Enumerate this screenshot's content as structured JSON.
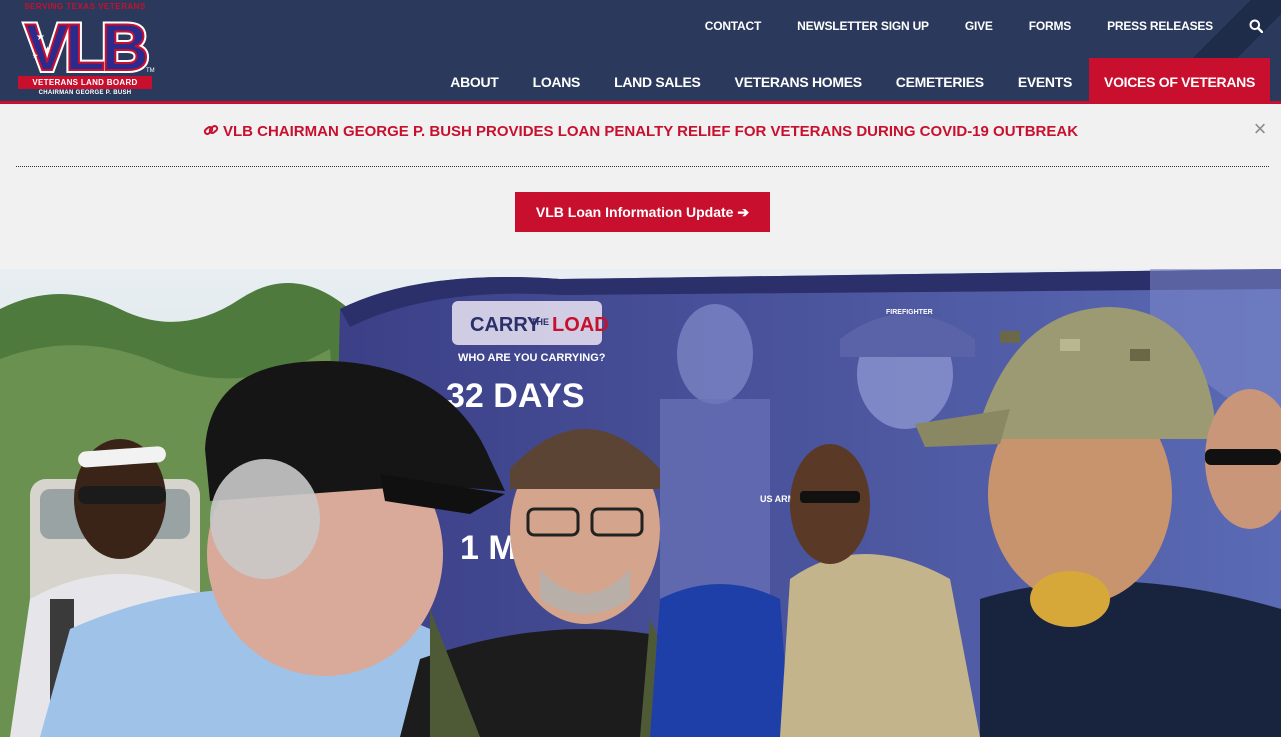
{
  "logo": {
    "tagline": "SERVING TEXAS VETERANS",
    "letters": "VLB",
    "trademark": "TM",
    "board": "VETERANS LAND BOARD",
    "chairman": "CHAIRMAN GEORGE P. BUSH"
  },
  "utility_nav": [
    "CONTACT",
    "NEWSLETTER SIGN UP",
    "GIVE",
    "FORMS",
    "PRESS RELEASES"
  ],
  "main_nav": [
    "ABOUT",
    "LOANS",
    "LAND SALES",
    "VETERANS HOMES",
    "CEMETERIES",
    "EVENTS",
    "VOICES OF VETERANS"
  ],
  "alert": {
    "headline": "VLB CHAIRMAN GEORGE P. BUSH PROVIDES LOAN PENALTY RELIEF FOR VETERANS DURING COVID-19 OUTBREAK",
    "close": "×",
    "button_label": "VLB Loan Information Update ➔"
  },
  "hero": {
    "bus_logo_line1": "CARRY",
    "bus_logo_line2": "THE",
    "bus_logo_line3": "LOAD",
    "bus_slogan": "WHO ARE YOU CARRYING?",
    "bus_text1": "32 DAYS",
    "bus_text2": "1 MIS",
    "helmet_text": "FIREFIGHTER",
    "patch_text": "US ARMY"
  },
  "colors": {
    "header_bg": "#2b3a5c",
    "accent_red": "#c8102e",
    "alert_bg": "#f1f1f1"
  }
}
